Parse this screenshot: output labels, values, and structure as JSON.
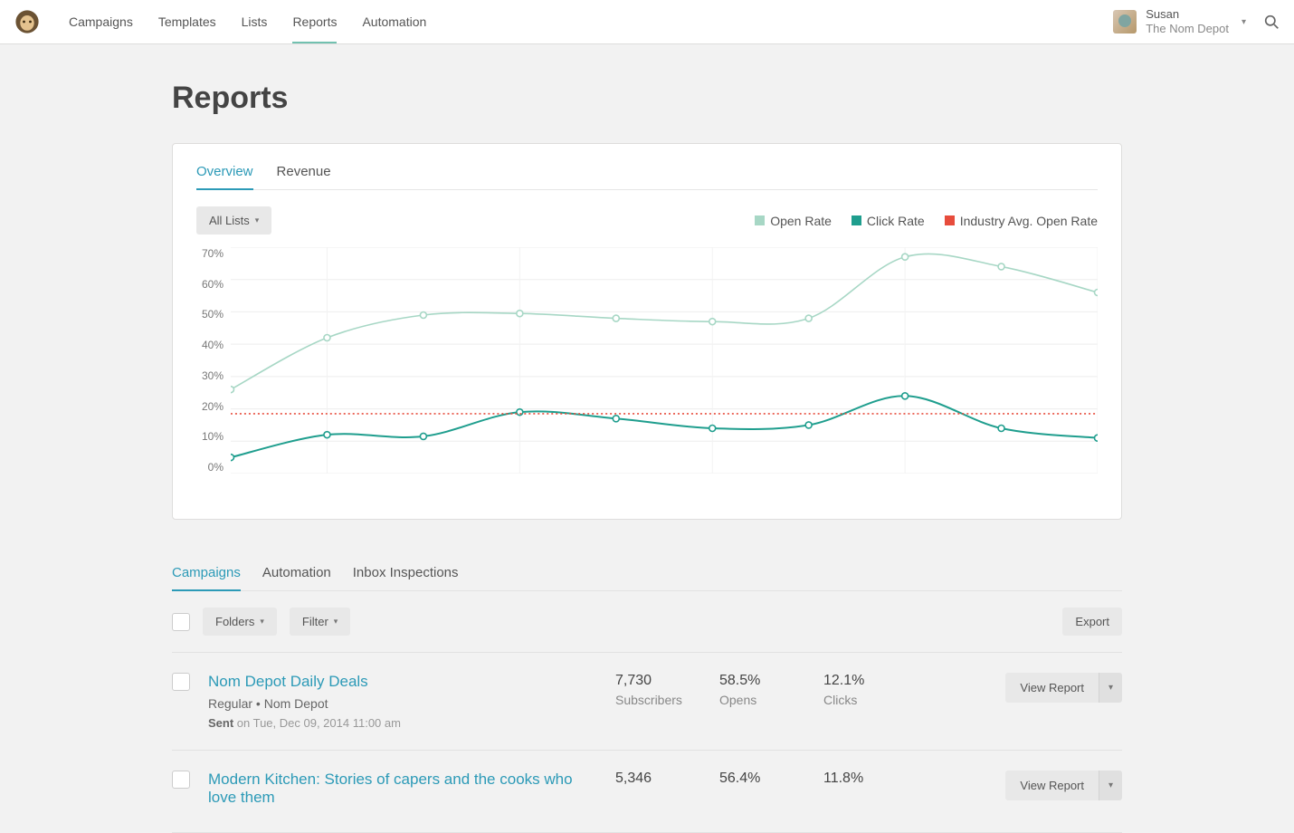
{
  "nav": {
    "items": [
      "Campaigns",
      "Templates",
      "Lists",
      "Reports",
      "Automation"
    ],
    "active": 3
  },
  "user": {
    "name": "Susan",
    "company": "The Nom Depot"
  },
  "page": {
    "title": "Reports"
  },
  "card": {
    "tabs": [
      "Overview",
      "Revenue"
    ],
    "active": 0,
    "dropdown": "All Lists",
    "legend": [
      {
        "label": "Open Rate",
        "color": "#a7d7c5"
      },
      {
        "label": "Click Rate",
        "color": "#1f9e8e"
      },
      {
        "label": "Industry Avg. Open Rate",
        "color": "#e74c3c"
      }
    ]
  },
  "chart_data": {
    "type": "line",
    "ylabel": "%",
    "ylim": [
      0,
      70
    ],
    "ytick_labels": [
      "70%",
      "60%",
      "50%",
      "40%",
      "30%",
      "20%",
      "10%",
      "0%"
    ],
    "x": [
      0,
      1,
      2,
      3,
      4,
      5,
      6,
      7,
      8,
      9
    ],
    "series": [
      {
        "name": "Open Rate",
        "color": "#a7d7c5",
        "values": [
          26,
          42,
          49,
          49.5,
          48,
          47,
          48,
          67,
          64,
          56
        ]
      },
      {
        "name": "Click Rate",
        "color": "#1f9e8e",
        "values": [
          5,
          12,
          11.5,
          19,
          17,
          14,
          15,
          24,
          14,
          11
        ]
      },
      {
        "name": "Industry Avg. Open Rate",
        "color": "#e74c3c",
        "style": "dashed",
        "values": [
          18.5,
          18.5,
          18.5,
          18.5,
          18.5,
          18.5,
          18.5,
          18.5,
          18.5,
          18.5
        ]
      }
    ]
  },
  "tabs2": {
    "items": [
      "Campaigns",
      "Automation",
      "Inbox Inspections"
    ],
    "active": 0
  },
  "toolbar": {
    "folders": "Folders",
    "filter": "Filter",
    "export": "Export"
  },
  "rows": [
    {
      "title": "Nom Depot Daily Deals",
      "subtitle": "Regular • Nom Depot",
      "sent_label": "Sent",
      "sent_rest": " on Tue, Dec 09, 2014 11:00 am",
      "stats": [
        {
          "val": "7,730",
          "lbl": "Subscribers"
        },
        {
          "val": "58.5%",
          "lbl": "Opens"
        },
        {
          "val": "12.1%",
          "lbl": "Clicks"
        }
      ],
      "action": "View Report"
    },
    {
      "title": "Modern Kitchen: Stories of capers and the cooks who love them",
      "subtitle": "",
      "sent_label": "",
      "sent_rest": "",
      "stats": [
        {
          "val": "5,346",
          "lbl": ""
        },
        {
          "val": "56.4%",
          "lbl": ""
        },
        {
          "val": "11.8%",
          "lbl": ""
        }
      ],
      "action": "View Report"
    }
  ]
}
